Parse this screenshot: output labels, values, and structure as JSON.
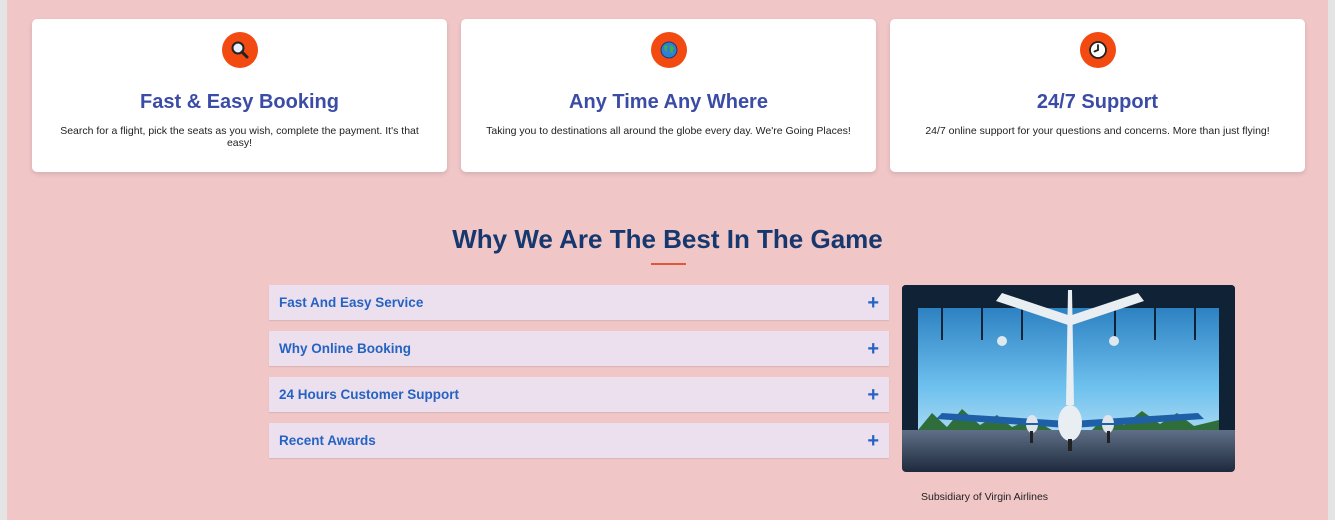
{
  "features": [
    {
      "icon": "magnifier-icon",
      "title": "Fast & Easy Booking",
      "description": "Search for a flight, pick the seats as you wish, complete the payment. It's that easy!"
    },
    {
      "icon": "globe-icon",
      "title": "Any Time Any Where",
      "description": "Taking you to destinations all around the globe every day. We're Going Places!"
    },
    {
      "icon": "clock-icon",
      "title": "24/7 Support",
      "description": "24/7 online support for your questions and concerns. More than just flying!"
    }
  ],
  "why": {
    "title": "Why We Are The Best In The Game",
    "items": [
      {
        "label": "Fast And Easy Service"
      },
      {
        "label": "Why Online Booking"
      },
      {
        "label": "24 Hours Customer Support"
      },
      {
        "label": "Recent Awards"
      }
    ],
    "expand_symbol": "+",
    "image_caption": "Subsidiary of Virgin Airlines"
  },
  "colors": {
    "background": "#f0c6c7",
    "accent": "#f24a10",
    "card_title": "#3b4ca6",
    "section_title": "#16386e",
    "accordion_text": "#2463c4",
    "accordion_bg": "#ede0ee"
  }
}
